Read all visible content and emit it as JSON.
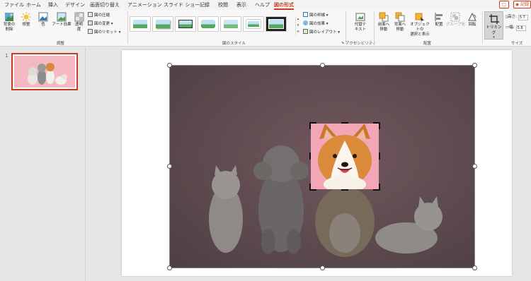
{
  "tabs": [
    "ファイル",
    "ホーム",
    "挿入",
    "デザイン",
    "画面切り替え",
    "アニメーション",
    "スライド ショー",
    "記録",
    "校閲",
    "表示",
    "ヘルプ",
    "図の形式"
  ],
  "top_right": {
    "comment_btn": "□",
    "record_btn": "◉ 記録"
  },
  "ribbon": {
    "adjust": {
      "remove_bg": "背景の\n削除",
      "corrections": "修整",
      "color": "色",
      "artistic": "アート効果",
      "transparency": "透明\n度",
      "compress": "図の圧縮",
      "change": "図の変更",
      "reset": "図のリセット",
      "group_label": "調整"
    },
    "styles": {
      "border": "図の枠線",
      "effects": "図の効果",
      "layout": "図のレイアウト",
      "group_label": "図のスタイル"
    },
    "accessibility": {
      "alt_text": "代替テ\nキスト",
      "group_label": "アクセシビリティ"
    },
    "arrange": {
      "bring_forward": "前面へ\n移動",
      "send_backward": "背面へ\n移動",
      "selection_pane": "オブジェクトの\n選択と表示",
      "align": "配置",
      "group": "グループ化",
      "rotate": "回転",
      "group_label": "配置"
    },
    "size": {
      "crop": "トリミング",
      "height_label": "高さ:",
      "height_value": "5.7",
      "width_label": "幅:",
      "width_value": "5.8",
      "group_label": "サイズ"
    }
  },
  "slides": {
    "current_number": "1"
  },
  "colors": {
    "accent": "#c43e1c",
    "pink_bg": "#f3a6b6",
    "photo_bg": "#5d4a4e"
  }
}
